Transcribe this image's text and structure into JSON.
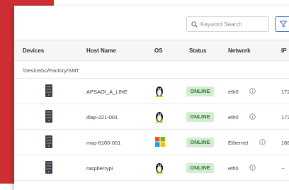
{
  "search": {
    "placeholder": "Keyword Search"
  },
  "table": {
    "columns": [
      "Devices",
      "Host Name",
      "OS",
      "Status",
      "Network",
      "IP"
    ],
    "group": "/DeviceGo/Factory/SMT",
    "rows": [
      {
        "device_icon": "server-box-icon",
        "host": "APSAOI_A_LINE",
        "os_icon": "linux-penguin-icon",
        "status": "ONLINE",
        "network": "eth0",
        "ip": "172"
      },
      {
        "device_icon": "server-box-icon",
        "host": "dlap-221-001",
        "os_icon": "linux-penguin-icon",
        "status": "ONLINE",
        "network": "eth0",
        "ip": "172"
      },
      {
        "device_icon": "server-box-icon",
        "host": "mvp-6100-001",
        "os_icon": "windows-logo-icon",
        "status": "ONLINE",
        "network": "Ethernet",
        "ip": "168"
      },
      {
        "device_icon": "server-box-icon",
        "host": "raspberrypi",
        "os_icon": "linux-penguin-icon",
        "status": "ONLINE",
        "network": "eth0",
        "ip": "--"
      }
    ]
  },
  "colors": {
    "accent": "#cf2f33",
    "status_bg": "#d5ecd3",
    "status_text": "#2e7d32",
    "filter_border": "#3d6fd8"
  }
}
